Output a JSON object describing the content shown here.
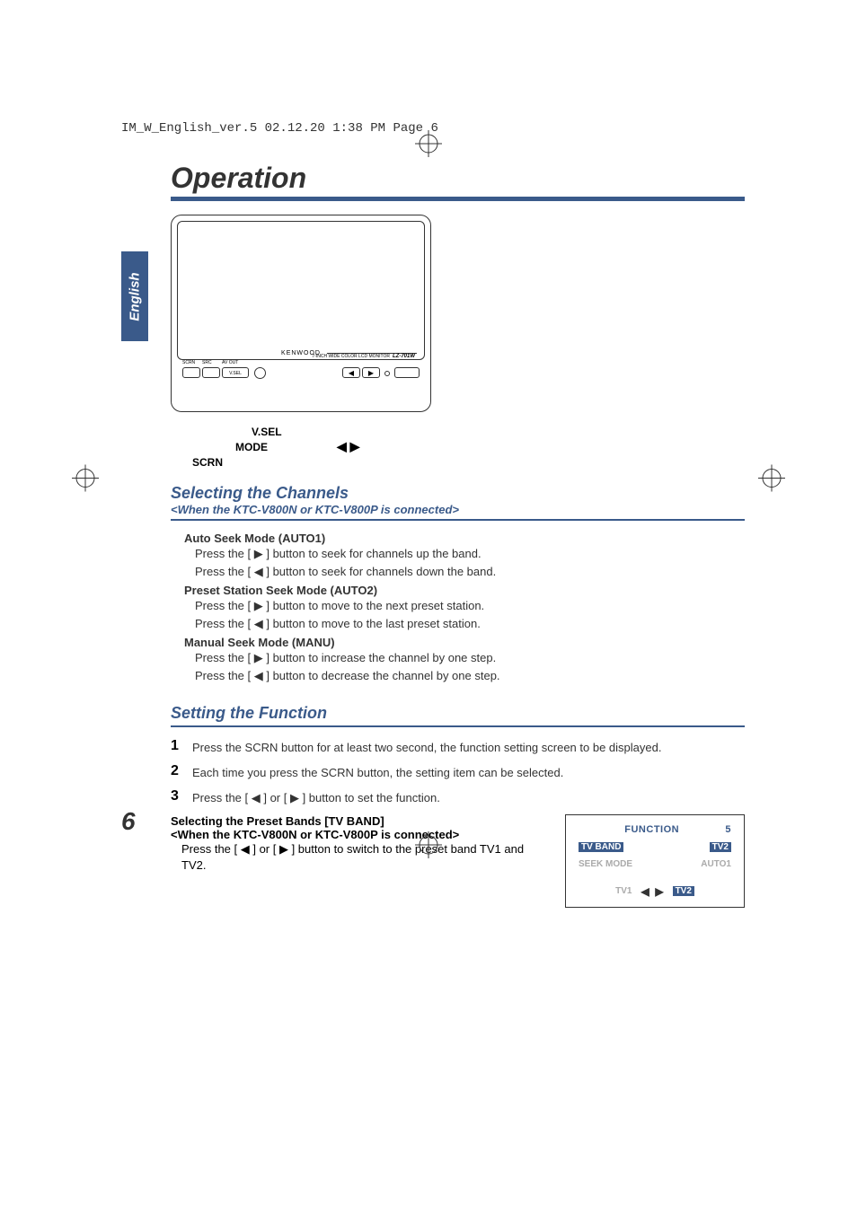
{
  "print_header": "IM_W_English_ver.5  02.12.20  1:38 PM  Page 6",
  "language_tab": "English",
  "section_title": "Operation",
  "device": {
    "brand": "KENWOOD",
    "subtext": "7-INCH WIDE COLOR LCD MONITOR",
    "model": "LZ-701W",
    "left_label_scrn": "SCRN",
    "left_label_src": "SRC",
    "left_label_avout": "AV OUT",
    "button_vsel": "V.SEL"
  },
  "annotations": {
    "vsel": "V.SEL",
    "mode": "MODE",
    "scrn": "SCRN",
    "arrows": "◀  ▶"
  },
  "selecting_channels": {
    "title": "Selecting the Channels",
    "subtitle": "<When the KTC-V800N or KTC-V800P is connected>",
    "auto1": {
      "title": "Auto Seek Mode (AUTO1)",
      "line1": "Press the [ ▶ ] button to seek for channels up the band.",
      "line2": "Press the [ ◀ ] button to seek for channels down the band."
    },
    "auto2": {
      "title": "Preset Station Seek Mode (AUTO2)",
      "line1": "Press the [ ▶ ] button to move to the next preset station.",
      "line2": "Press the [ ◀ ] button to move to the last preset station."
    },
    "manu": {
      "title": "Manual Seek Mode (MANU)",
      "line1": "Press the [ ▶ ] button to increase the channel by one step.",
      "line2": "Press the [ ◀ ] button to decrease the channel by one step."
    }
  },
  "setting_function": {
    "title": "Setting the Function",
    "step1": "Press the SCRN button for at least two second, the function setting screen to be displayed.",
    "step2": "Each time you press the SCRN button, the setting item can be selected.",
    "step3": "Press the [ ◀ ] or [ ▶ ] button to set the function.",
    "preset": {
      "heading": "Selecting the Preset Bands [TV BAND]",
      "sub": "<When the KTC-V800N or KTC-V800P is connected>",
      "body": "Press the [ ◀ ] or [ ▶ ] button to switch to the preset band TV1 and TV2."
    }
  },
  "function_box": {
    "title": "FUNCTION",
    "title_num": "5",
    "row1_label": "TV BAND",
    "row1_value": "TV2",
    "row2_label": "SEEK MODE",
    "row2_value": "AUTO1",
    "footer_left": "TV1",
    "footer_right": "TV2"
  },
  "page_number": "6"
}
